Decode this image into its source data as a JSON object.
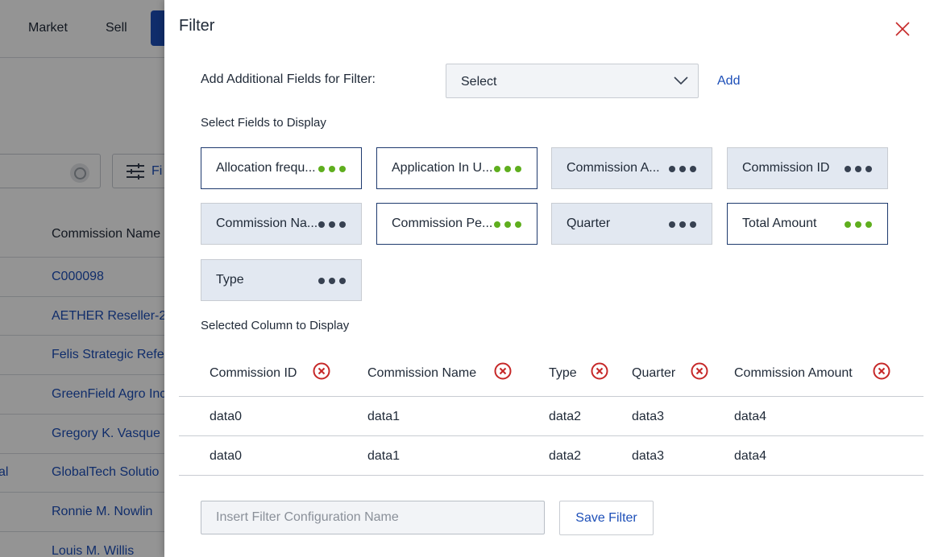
{
  "background": {
    "nav": [
      "Market",
      "Sell"
    ],
    "filter_label": "Fi",
    "column_header": "Commission Name",
    "rows": [
      {
        "name": "C000098",
        "left": ""
      },
      {
        "name": "AETHER Reseller-2",
        "left": ""
      },
      {
        "name": "Felis Strategic Refe",
        "left": ""
      },
      {
        "name": "GreenField Agro Inc",
        "left": ""
      },
      {
        "name": "Gregory K. Vasque",
        "left": ""
      },
      {
        "name": "GlobalTech Solutio",
        "left": "al"
      },
      {
        "name": "Ronnie M. Nowlin",
        "left": ""
      },
      {
        "name": "Louis M. Willis",
        "left": ""
      }
    ]
  },
  "drawer": {
    "title": "Filter",
    "add_fields_label": "Add Additional Fields for Filter:",
    "select_value": "Select",
    "add_link": "Add",
    "select_fields_label": "Select Fields to Display",
    "fields": [
      {
        "name": "Allocation frequ...",
        "selected": true
      },
      {
        "name": "Application In U...",
        "selected": true
      },
      {
        "name": "Commission A...",
        "selected": false
      },
      {
        "name": "Commission ID",
        "selected": false
      },
      {
        "name": "Commission Na...",
        "selected": false
      },
      {
        "name": "Commission Pe...",
        "selected": true
      },
      {
        "name": "Quarter",
        "selected": false
      },
      {
        "name": "Total Amount",
        "selected": true
      },
      {
        "name": "Type",
        "selected": false
      }
    ],
    "selected_columns_label": "Selected Column to Display",
    "columns": [
      "Commission ID",
      "Commission Name",
      "Type",
      "Quarter",
      "Commission Amount"
    ],
    "rows": [
      [
        "data0",
        "data1",
        "data2",
        "data3",
        "data4"
      ],
      [
        "data0",
        "data1",
        "data2",
        "data3",
        "data4"
      ]
    ],
    "config_name_placeholder": "Insert Filter Configuration Name",
    "save_button": "Save Filter"
  },
  "colors": {
    "accent": "#1d4fb8",
    "selected_dots": "#5fae1e",
    "remove_icon": "#c62828"
  }
}
